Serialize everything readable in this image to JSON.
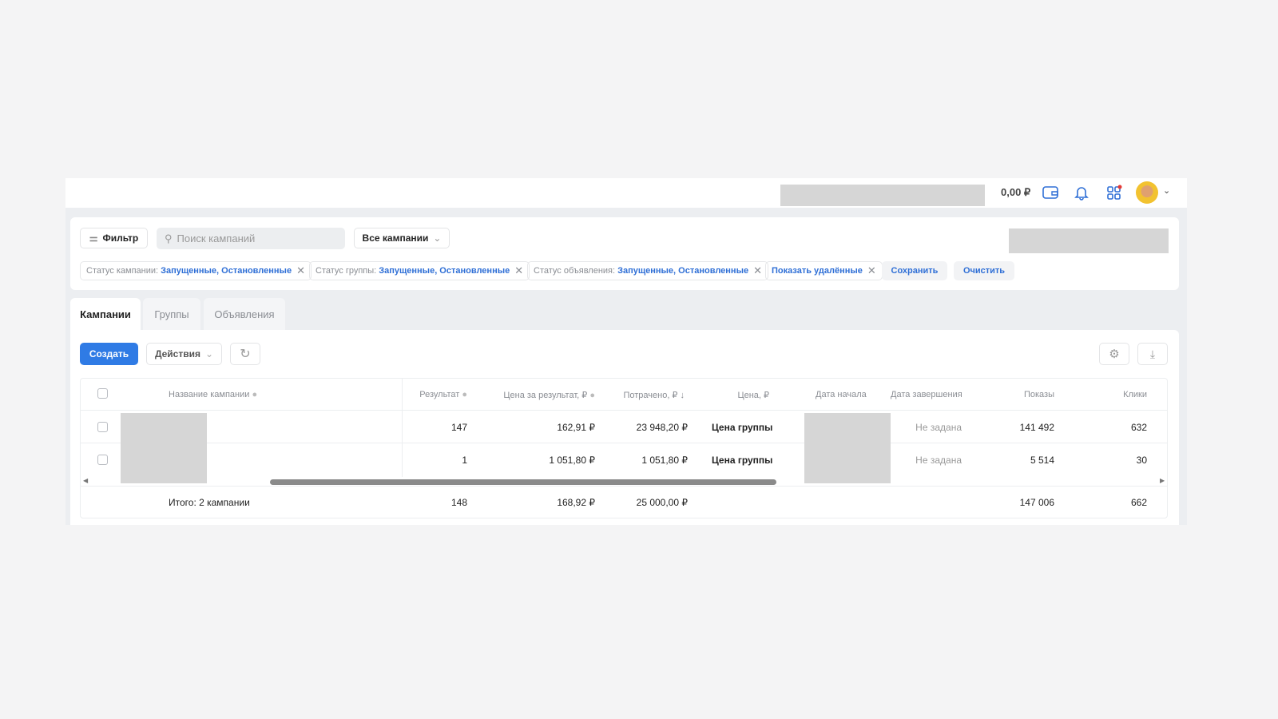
{
  "header": {
    "balance": "0,00 ₽",
    "icons": [
      "wallet-icon",
      "bell-icon",
      "apps-icon",
      "avatar"
    ]
  },
  "toolbar": {
    "filter_label": "Фильтр",
    "search_placeholder": "Поиск кампаний",
    "campaigns_select": "Все кампании"
  },
  "chips": [
    {
      "label": "Статус кампании:",
      "value": "Запущенные, Остановленные"
    },
    {
      "label": "Статус группы:",
      "value": "Запущенные, Остановленные"
    },
    {
      "label": "Статус объявления:",
      "value": "Запущенные, Остановленные"
    },
    {
      "label": "",
      "value": "Показать удалённые"
    }
  ],
  "chip_close": "✕",
  "save_label": "Сохранить",
  "clear_label": "Очистить",
  "tabs": [
    "Кампании",
    "Группы",
    "Объявления"
  ],
  "actions": {
    "create": "Создать",
    "actions": "Действия"
  },
  "table": {
    "columns": [
      "Название кампании",
      "Результат",
      "Цена за результат, ₽",
      "Потрачено, ₽ ↓",
      "Цена, ₽",
      "Дата начала",
      "Дата завершения",
      "Показы",
      "Клики"
    ],
    "rows": [
      {
        "result": "147",
        "cpr": "162,91 ₽",
        "spent": "23 948,20 ₽",
        "price": "Цена группы",
        "end": "Не задана",
        "shows": "141 492",
        "clicks": "632"
      },
      {
        "result": "1",
        "cpr": "1 051,80 ₽",
        "spent": "1 051,80 ₽",
        "price": "Цена группы",
        "end": "Не задана",
        "shows": "5 514",
        "clicks": "30"
      }
    ],
    "total": {
      "label": "Итого: 2 кампании",
      "result": "148",
      "cpr": "168,92 ₽",
      "spent": "25 000,00 ₽",
      "shows": "147 006",
      "clicks": "662"
    }
  }
}
